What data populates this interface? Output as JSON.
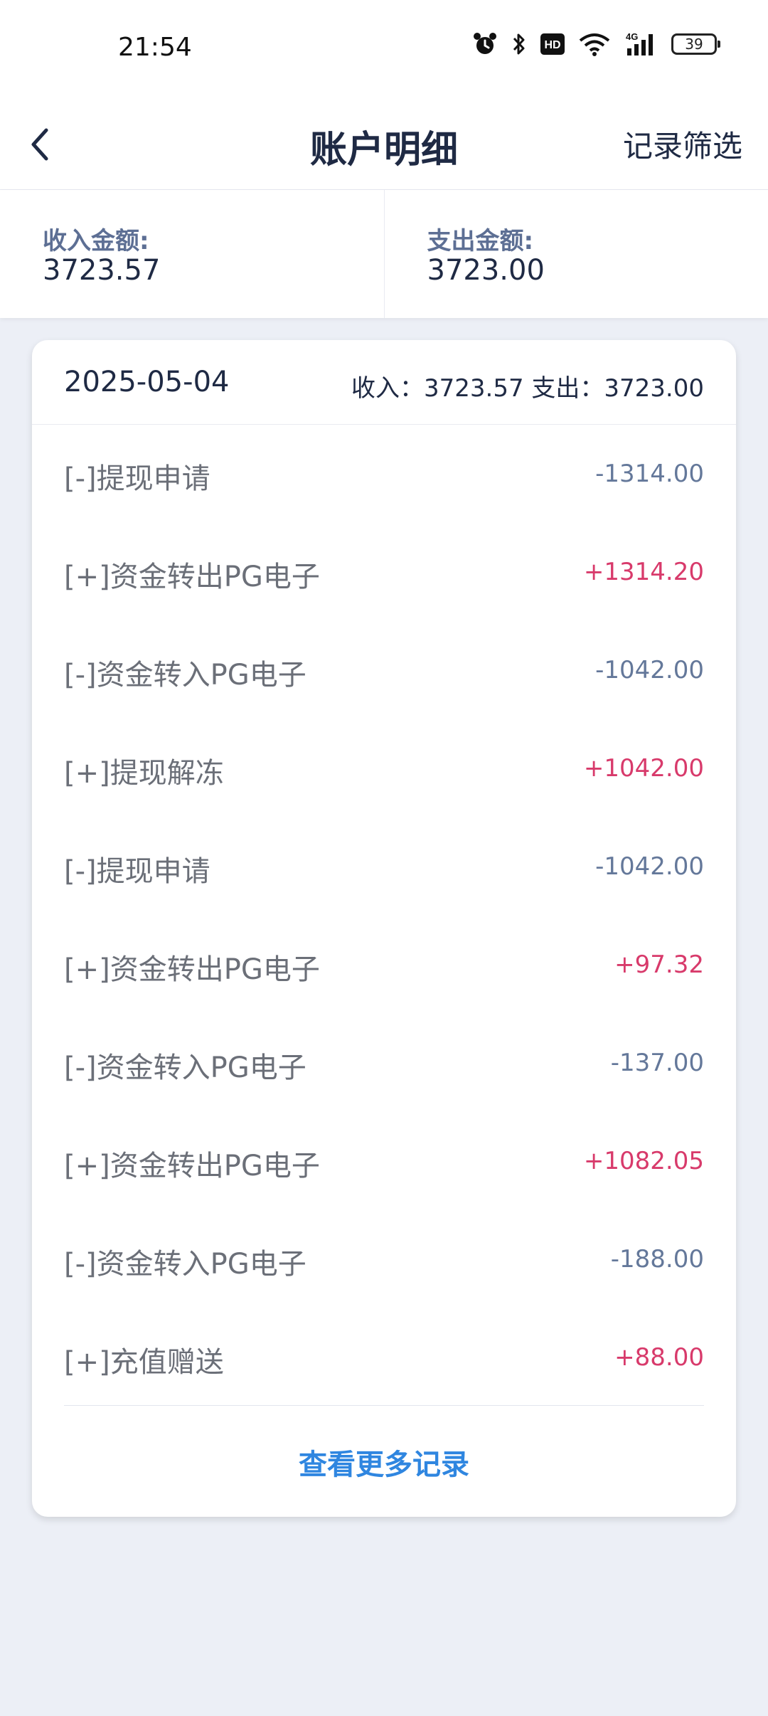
{
  "status_bar": {
    "time": "21:54",
    "battery": "39",
    "icons": [
      "alarm-icon",
      "bluetooth-icon",
      "hd-icon",
      "wifi-icon",
      "4g-signal-icon",
      "battery-icon"
    ]
  },
  "nav": {
    "title": "账户明细",
    "filter_label": "记录筛选",
    "back_icon": "chevron-left-icon"
  },
  "summary": {
    "income_label": "收入金额:",
    "income_value": "3723.57",
    "expense_label": "支出金额:",
    "expense_value": "3723.00"
  },
  "day": {
    "date": "2025-05-04",
    "totals": "收入：3723.57 支出：3723.00"
  },
  "records": [
    {
      "label": "[-]提现申请",
      "amount": "-1314.00",
      "type": "neg"
    },
    {
      "label": "[+]资金转出PG电子",
      "amount": "+1314.20",
      "type": "pos"
    },
    {
      "label": "[-]资金转入PG电子",
      "amount": "-1042.00",
      "type": "neg"
    },
    {
      "label": "[+]提现解冻",
      "amount": "+1042.00",
      "type": "pos"
    },
    {
      "label": "[-]提现申请",
      "amount": "-1042.00",
      "type": "neg"
    },
    {
      "label": "[+]资金转出PG电子",
      "amount": "+97.32",
      "type": "pos"
    },
    {
      "label": "[-]资金转入PG电子",
      "amount": "-137.00",
      "type": "neg"
    },
    {
      "label": "[+]资金转出PG电子",
      "amount": "+1082.05",
      "type": "pos"
    },
    {
      "label": "[-]资金转入PG电子",
      "amount": "-188.00",
      "type": "neg"
    },
    {
      "label": "[+]充值赠送",
      "amount": "+88.00",
      "type": "pos"
    }
  ],
  "more_label": "查看更多记录",
  "colors": {
    "positive": "#d83a6b",
    "negative": "#64789a",
    "link": "#2f86e0",
    "background": "#eceff6"
  }
}
